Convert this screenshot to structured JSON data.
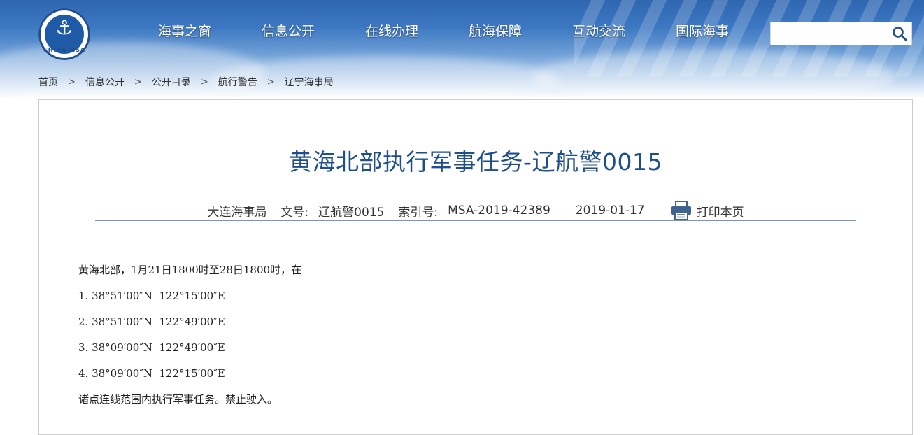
{
  "logo": {
    "text": "CHINA MSA"
  },
  "nav": [
    "海事之窗",
    "信息公开",
    "在线办理",
    "航海保障",
    "互动交流",
    "国际海事"
  ],
  "search": {
    "value": "",
    "placeholder": ""
  },
  "breadcrumb": [
    "首页",
    "信息公开",
    "公开目录",
    "航行警告",
    "辽宁海事局"
  ],
  "article": {
    "title": "黄海北部执行军事任务-辽航警0015",
    "issuer": "大连海事局",
    "doc_label": "文号:",
    "doc_no": "辽航警0015",
    "index_label": "索引号:",
    "index_no": "MSA-2019-42389",
    "date": "2019-01-17",
    "print_label": "打印本页",
    "lines": [
      "黄海北部，1月21日1800时至28日1800时，在",
      "1. 38°51′00″N  122°15′00″E",
      "2. 38°51′00″N  122°49′00″E",
      "3. 38°09′00″N  122°49′00″E",
      "4. 38°09′00″N  122°15′00″E",
      "诸点连线范围内执行军事任务。禁止驶入。"
    ]
  }
}
